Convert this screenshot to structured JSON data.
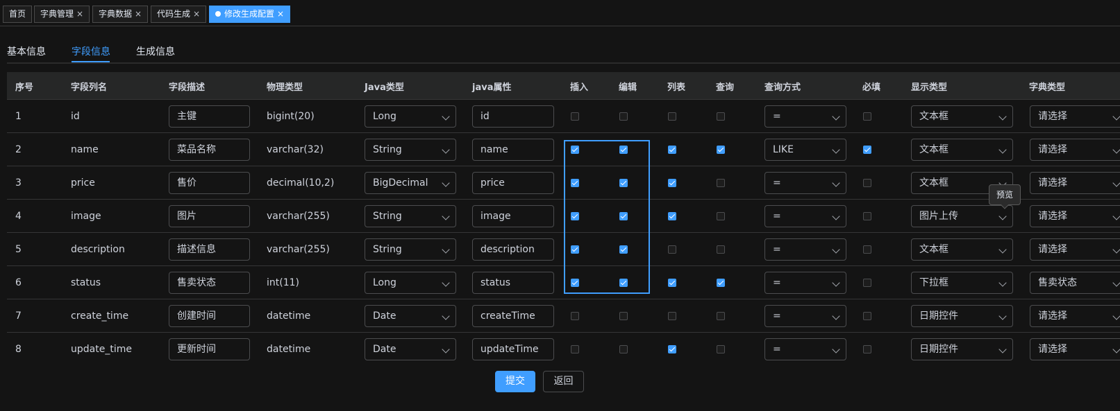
{
  "tags": [
    {
      "label": "首页",
      "closable": false
    },
    {
      "label": "字典管理",
      "closable": true
    },
    {
      "label": "字典数据",
      "closable": true
    },
    {
      "label": "代码生成",
      "closable": true
    },
    {
      "label": "修改生成配置",
      "closable": true,
      "active": true
    }
  ],
  "close_glyph": "×",
  "sub_tabs": [
    {
      "label": "基本信息"
    },
    {
      "label": "字段信息",
      "active": true
    },
    {
      "label": "生成信息"
    }
  ],
  "columns": [
    "序号",
    "字段列名",
    "字段描述",
    "物理类型",
    "Java类型",
    "java属性",
    "插入",
    "编辑",
    "列表",
    "查询",
    "查询方式",
    "必填",
    "显示类型",
    "字典类型"
  ],
  "rows": [
    {
      "no": "1",
      "column": "id",
      "desc": "主键",
      "db_type": "bigint(20)",
      "java_type": "Long",
      "java_field": "id",
      "insert": false,
      "edit": false,
      "list": false,
      "query": false,
      "query_type": "=",
      "required": false,
      "html_type": "文本框",
      "dict_type": "请选择"
    },
    {
      "no": "2",
      "column": "name",
      "desc": "菜品名称",
      "db_type": "varchar(32)",
      "java_type": "String",
      "java_field": "name",
      "insert": true,
      "edit": true,
      "list": true,
      "query": true,
      "query_type": "LIKE",
      "required": true,
      "html_type": "文本框",
      "dict_type": "请选择"
    },
    {
      "no": "3",
      "column": "price",
      "desc": "售价",
      "db_type": "decimal(10,2)",
      "java_type": "BigDecimal",
      "java_field": "price",
      "insert": true,
      "edit": true,
      "list": true,
      "query": false,
      "query_type": "=",
      "required": false,
      "html_type": "文本框",
      "dict_type": "请选择"
    },
    {
      "no": "4",
      "column": "image",
      "desc": "图片",
      "db_type": "varchar(255)",
      "java_type": "String",
      "java_field": "image",
      "insert": true,
      "edit": true,
      "list": true,
      "query": false,
      "query_type": "=",
      "required": false,
      "html_type": "图片上传",
      "dict_type": "请选择"
    },
    {
      "no": "5",
      "column": "description",
      "desc": "描述信息",
      "db_type": "varchar(255)",
      "java_type": "String",
      "java_field": "description",
      "insert": true,
      "edit": true,
      "list": false,
      "query": false,
      "query_type": "=",
      "required": false,
      "html_type": "文本框",
      "dict_type": "请选择"
    },
    {
      "no": "6",
      "column": "status",
      "desc": "售卖状态",
      "db_type": "int(11)",
      "java_type": "Long",
      "java_field": "status",
      "insert": true,
      "edit": true,
      "list": true,
      "query": true,
      "query_type": "=",
      "required": false,
      "html_type": "下拉框",
      "dict_type": "售卖状态"
    },
    {
      "no": "7",
      "column": "create_time",
      "desc": "创建时间",
      "db_type": "datetime",
      "java_type": "Date",
      "java_field": "createTime",
      "insert": false,
      "edit": false,
      "list": false,
      "query": false,
      "query_type": "=",
      "required": false,
      "html_type": "日期控件",
      "dict_type": "请选择"
    },
    {
      "no": "8",
      "column": "update_time",
      "desc": "更新时间",
      "db_type": "datetime",
      "java_type": "Date",
      "java_field": "updateTime",
      "insert": false,
      "edit": false,
      "list": true,
      "query": false,
      "query_type": "=",
      "required": false,
      "html_type": "日期控件",
      "dict_type": "请选择"
    }
  ],
  "tooltip": "预览",
  "buttons": {
    "submit": "提交",
    "back": "返回"
  },
  "colors": {
    "accent": "#409eff",
    "background": "#141414",
    "header": "#262727"
  }
}
